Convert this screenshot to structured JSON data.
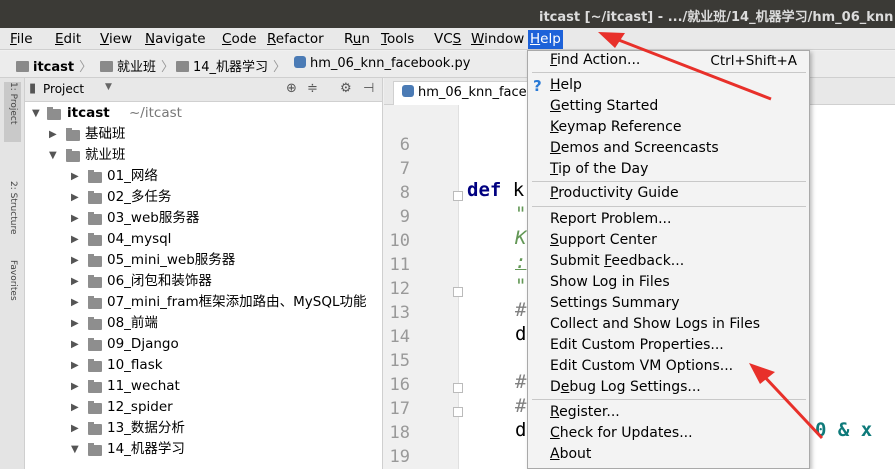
{
  "window": {
    "title": "itcast [~/itcast] - .../就业班/14_机器学习/hm_06_knn"
  },
  "menubar": {
    "items": [
      {
        "label": "File",
        "accel": "F"
      },
      {
        "label": "Edit",
        "accel": "E"
      },
      {
        "label": "View",
        "accel": "V"
      },
      {
        "label": "Navigate",
        "accel": "N"
      },
      {
        "label": "Code",
        "accel": "C"
      },
      {
        "label": "Refactor",
        "accel": "R"
      },
      {
        "label": "Run",
        "accel": "u"
      },
      {
        "label": "Tools",
        "accel": "T"
      },
      {
        "label": "VCS",
        "accel": "S"
      },
      {
        "label": "Window",
        "accel": "W"
      },
      {
        "label": "Help",
        "accel": "H",
        "active": true
      }
    ]
  },
  "breadcrumb": {
    "items": [
      "itcast",
      "就业班",
      "14_机器学习",
      "hm_06_knn_facebook.py"
    ]
  },
  "toolstrip": {
    "tabs": [
      "1: Project",
      "2: Structure",
      "Favorites"
    ]
  },
  "project": {
    "header_label": "Project",
    "root": {
      "name": "itcast",
      "path": "~/itcast"
    },
    "tree": [
      {
        "label": "基础班",
        "level": 1,
        "expanded": false
      },
      {
        "label": "就业班",
        "level": 1,
        "expanded": true
      },
      {
        "label": "01_网络",
        "level": 2,
        "expanded": false
      },
      {
        "label": "02_多任务",
        "level": 2,
        "expanded": false
      },
      {
        "label": "03_web服务器",
        "level": 2,
        "expanded": false
      },
      {
        "label": "04_mysql",
        "level": 2,
        "expanded": false
      },
      {
        "label": "05_mini_web服务器",
        "level": 2,
        "expanded": false
      },
      {
        "label": "06_闭包和装饰器",
        "level": 2,
        "expanded": false
      },
      {
        "label": "07_mini_fram框架添加路由、MySQL功能",
        "level": 2,
        "expanded": false
      },
      {
        "label": "08_前端",
        "level": 2,
        "expanded": false
      },
      {
        "label": "09_Django",
        "level": 2,
        "expanded": false
      },
      {
        "label": "10_flask",
        "level": 2,
        "expanded": false
      },
      {
        "label": "11_wechat",
        "level": 2,
        "expanded": false
      },
      {
        "label": "12_spider",
        "level": 2,
        "expanded": false
      },
      {
        "label": "13_数据分析",
        "level": 2,
        "expanded": false
      },
      {
        "label": "14_机器学习",
        "level": 2,
        "expanded": true
      }
    ]
  },
  "editor": {
    "tab_label": "hm_06_knn_face",
    "line_numbers": [
      "6",
      "7",
      "8",
      "9",
      "10",
      "11",
      "12",
      "13",
      "14",
      "15",
      "16",
      "17",
      "18",
      "19",
      "20"
    ],
    "code_fragments": [
      {
        "line": "8",
        "text": "def k"
      },
      {
        "line": "9",
        "text": "\""
      },
      {
        "line": "10",
        "text": "K"
      },
      {
        "line": "11",
        "text": ":"
      },
      {
        "line": "12",
        "text": "\""
      },
      {
        "line": "13",
        "text": "#"
      },
      {
        "line": "14",
        "text": "d"
      },
      {
        "line": "16",
        "text": "#"
      },
      {
        "line": "17",
        "text": "#"
      },
      {
        "line": "18",
        "text": "d"
      },
      {
        "line": "18",
        "text": "0 &  x"
      },
      {
        "line": "20",
        "text": "#"
      }
    ]
  },
  "help_menu": {
    "groups": [
      [
        {
          "label": "Find Action...",
          "accel": "F",
          "shortcut": "Ctrl+Shift+A"
        }
      ],
      [
        {
          "label": "Help",
          "accel": "H",
          "icon": "help-question-icon"
        },
        {
          "label": "Getting Started",
          "accel": "G"
        },
        {
          "label": "Keymap Reference",
          "accel": "K"
        },
        {
          "label": "Demos and Screencasts",
          "accel": "D"
        },
        {
          "label": "Tip of the Day",
          "accel": "T"
        }
      ],
      [
        {
          "label": "Productivity Guide",
          "accel": "P"
        }
      ],
      [
        {
          "label": "Report Problem...",
          "accel": ""
        },
        {
          "label": "Support Center",
          "accel": "S"
        },
        {
          "label": "Submit Feedback...",
          "accel": "F"
        },
        {
          "label": "Show Log in Files",
          "accel": ""
        },
        {
          "label": "Settings Summary",
          "accel": ""
        },
        {
          "label": "Collect and Show Logs in Files",
          "accel": ""
        },
        {
          "label": "Edit Custom Properties...",
          "accel": ""
        },
        {
          "label": "Edit Custom VM Options...",
          "accel": ""
        },
        {
          "label": "Debug Log Settings...",
          "accel": "e"
        }
      ],
      [
        {
          "label": "Register...",
          "accel": "R"
        },
        {
          "label": "Check for Updates...",
          "accel": "C"
        },
        {
          "label": "About",
          "accel": "A"
        }
      ]
    ]
  },
  "colors": {
    "annotation_arrow": "#e8302a",
    "menu_active": "#1d62d9",
    "keyword": "#000080",
    "comment": "#808080",
    "string_doc": "#629755"
  }
}
